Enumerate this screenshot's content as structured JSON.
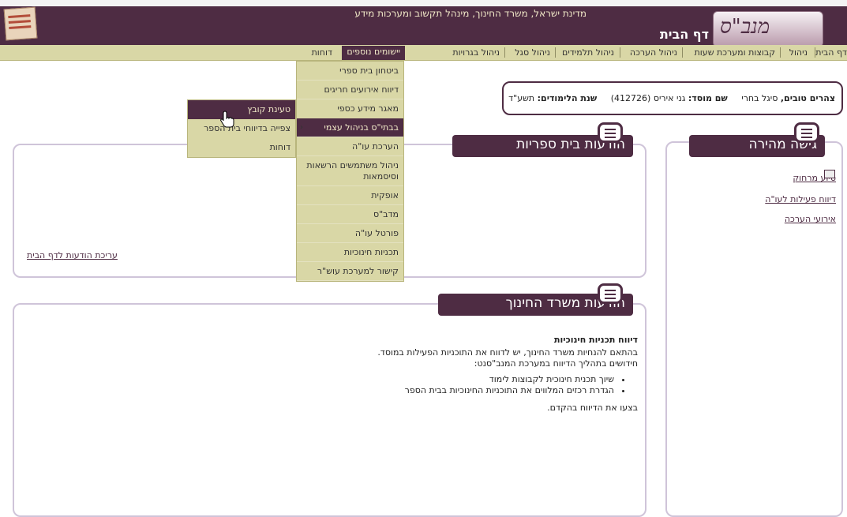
{
  "header": {
    "subtitle": "מדינת ישראל, משרד החינוך, מינהל תקשוב ומערכות מידע",
    "page_title": "דף הבית",
    "logo_text": "מנב\"ס"
  },
  "menubar": {
    "items": [
      {
        "label": "דף הבית"
      },
      {
        "label": "ניהול"
      },
      {
        "label": "קבוצות ומערכת שעות"
      },
      {
        "label": "ניהול הערכה"
      },
      {
        "label": "ניהול תלמידים"
      },
      {
        "label": "ניהול סגל"
      },
      {
        "label": "ניהול בגרויות"
      },
      {
        "label": "יישומים נוספים"
      },
      {
        "label": "דוחות"
      }
    ]
  },
  "dropdown": {
    "items": [
      {
        "label": "ביטחון בית ספרי"
      },
      {
        "label": "דיווח אירועים חריגים"
      },
      {
        "label": "מאגר מידע כספי"
      },
      {
        "label": "בבתי\"ס בניהול עצמי"
      },
      {
        "label": "הערכת עו\"ה"
      },
      {
        "label": "ניהול משתמשים הרשאות וסיסמאות"
      },
      {
        "label": "אופקית"
      },
      {
        "label": "מדב\"ס"
      },
      {
        "label": "פורטל עו\"ה"
      },
      {
        "label": "תכניות חינוכיות"
      },
      {
        "label": "קישור למערכת עוש\"ר"
      }
    ]
  },
  "submenu": {
    "items": [
      {
        "label": "טעינת קובץ"
      },
      {
        "label": "צפייה בדיווחי בית הספר"
      },
      {
        "label": "דוחות"
      }
    ]
  },
  "infobar": {
    "school_name": "צהרים טובים,",
    "staff": "סיגל בחרי",
    "institution_label": "שם מוסד:",
    "institution_value": "גני איריס (412726)",
    "year_label": "שנת הלימודים:",
    "year_value": "תשע\"ד"
  },
  "quick_access": {
    "title": "גישה מהירה",
    "links": [
      "סיוע מרחוק",
      "דיווח פעילות לעו\"ה",
      "אירועי הערכה"
    ]
  },
  "school_messages": {
    "title": "הודעות בית ספריות",
    "edit_link": "עריכת הודעות לדף הבית"
  },
  "ministry_messages": {
    "title": "הודעות משרד החינוך",
    "heading": "דיווח תכניות חינוכיות",
    "line1": "בהתאם להנחיות משרד החינוך, יש לדווח את התוכניות הפעילות במוסד.",
    "line2": "חידושים בתהליך הדיווח במערכת המנב\"סנט:",
    "bullets": [
      "שיוך תכנית חינוכית לקבוצות לימוד",
      "הגדרת רכזים המלווים את התוכניות החינוכיות בבית הספר"
    ],
    "closing": "בצעו את הדיווח בהקדם."
  },
  "colors": {
    "brand": "#4e2c43",
    "menu_bg": "#d9d7a6",
    "panel_border": "#cfc4d9"
  }
}
